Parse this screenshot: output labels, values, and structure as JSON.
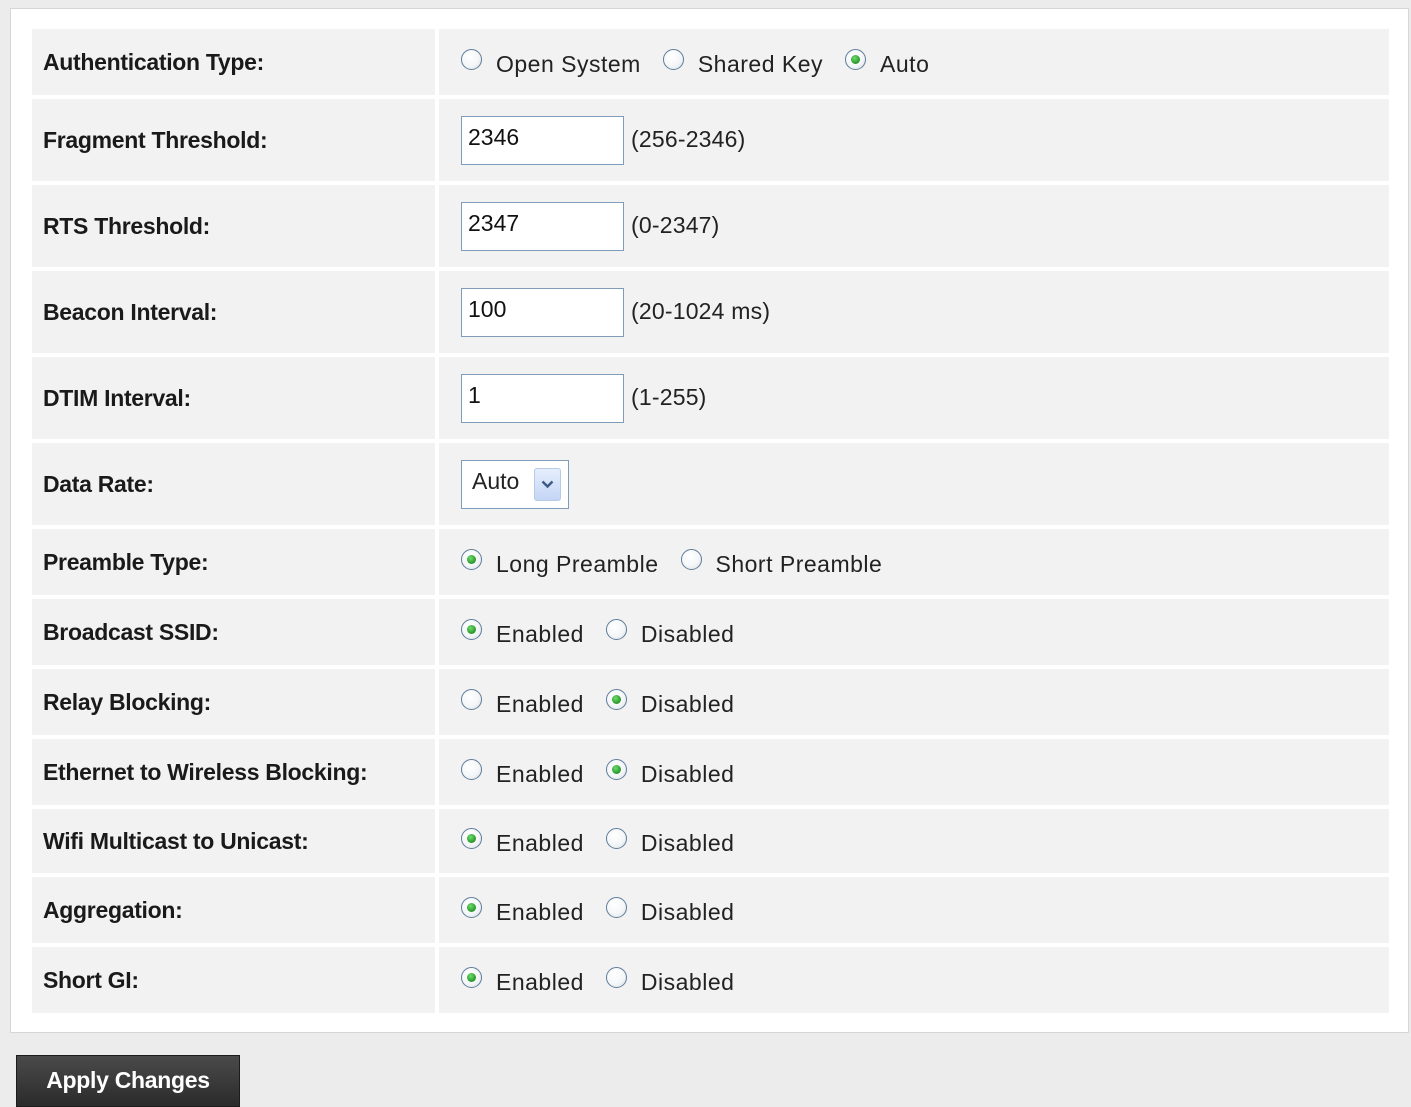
{
  "settings": [
    {
      "label": "Authentication Type:",
      "type": "radio",
      "options": [
        {
          "label": "Open System",
          "checked": false
        },
        {
          "label": "Shared Key",
          "checked": false
        },
        {
          "label": "Auto",
          "checked": true
        }
      ]
    },
    {
      "label": "Fragment Threshold:",
      "type": "text",
      "value": "2346",
      "range": "(256-2346)"
    },
    {
      "label": "RTS Threshold:",
      "type": "text",
      "value": "2347",
      "range": "(0-2347)"
    },
    {
      "label": "Beacon Interval:",
      "type": "text",
      "value": "100",
      "range": "(20-1024 ms)"
    },
    {
      "label": "DTIM Interval:",
      "type": "text",
      "value": "1",
      "range": "(1-255)"
    },
    {
      "label": "Data Rate:",
      "type": "select",
      "value": "Auto"
    },
    {
      "label": "Preamble Type:",
      "type": "radio",
      "options": [
        {
          "label": "Long Preamble",
          "checked": true
        },
        {
          "label": "Short Preamble",
          "checked": false
        }
      ]
    },
    {
      "label": "Broadcast SSID:",
      "type": "radio",
      "options": [
        {
          "label": "Enabled",
          "checked": true
        },
        {
          "label": "Disabled",
          "checked": false
        }
      ]
    },
    {
      "label": "Relay Blocking:",
      "type": "radio",
      "options": [
        {
          "label": "Enabled",
          "checked": false
        },
        {
          "label": "Disabled",
          "checked": true
        }
      ]
    },
    {
      "label": "Ethernet to Wireless Blocking:",
      "type": "radio",
      "options": [
        {
          "label": "Enabled",
          "checked": false
        },
        {
          "label": "Disabled",
          "checked": true
        }
      ]
    },
    {
      "label": "Wifi Multicast to Unicast:",
      "type": "radio",
      "options": [
        {
          "label": "Enabled",
          "checked": true
        },
        {
          "label": "Disabled",
          "checked": false
        }
      ]
    },
    {
      "label": "Aggregation:",
      "type": "radio",
      "options": [
        {
          "label": "Enabled",
          "checked": true
        },
        {
          "label": "Disabled",
          "checked": false
        }
      ]
    },
    {
      "label": "Short GI:",
      "type": "radio",
      "options": [
        {
          "label": "Enabled",
          "checked": true
        },
        {
          "label": "Disabled",
          "checked": false
        }
      ]
    }
  ],
  "apply_button": "Apply Changes",
  "colors": {
    "row_bg": "#f2f2f2",
    "page_bg": "#ececec",
    "radio_checked": "#2fa02f",
    "button_bg": "#3a3a3a"
  }
}
